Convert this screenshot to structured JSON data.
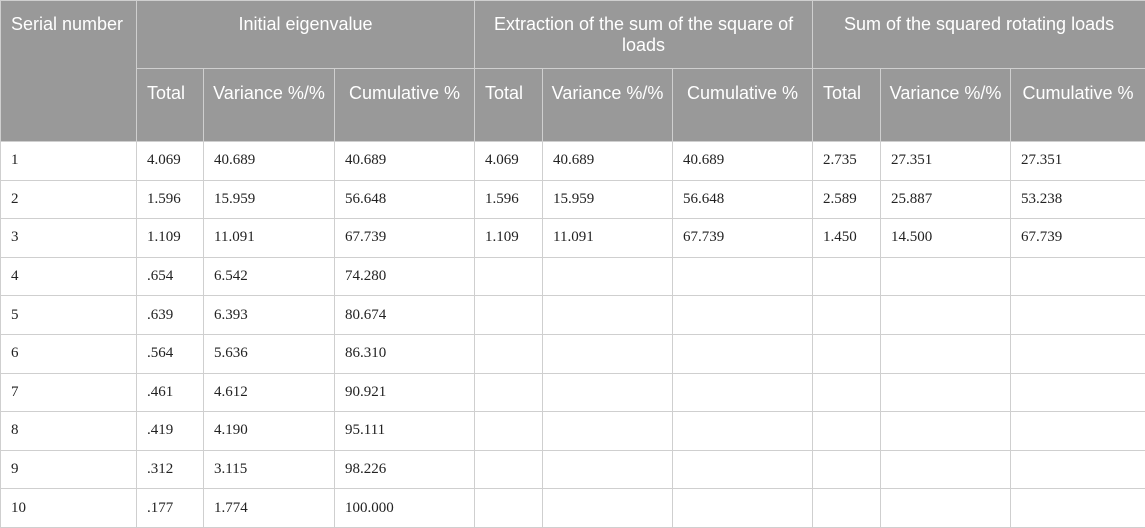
{
  "header": {
    "serial_number": "Serial number",
    "groups": [
      "Initial eigenvalue",
      "Extraction of the sum of the square of loads",
      "Sum of the squared rotating loads"
    ],
    "sub_total": "Total",
    "sub_variance": "Variance %/%",
    "sub_cumulative": "Cumulative %"
  },
  "rows": [
    [
      "1",
      "4.069",
      "40.689",
      "40.689",
      "4.069",
      "40.689",
      "40.689",
      "2.735",
      "27.351",
      "27.351"
    ],
    [
      "2",
      "1.596",
      "15.959",
      "56.648",
      "1.596",
      "15.959",
      "56.648",
      "2.589",
      "25.887",
      "53.238"
    ],
    [
      "3",
      "1.109",
      "11.091",
      "67.739",
      "1.109",
      "11.091",
      "67.739",
      "1.450",
      "14.500",
      "67.739"
    ],
    [
      "4",
      ".654",
      "6.542",
      "74.280",
      "",
      "",
      "",
      "",
      "",
      ""
    ],
    [
      "5",
      ".639",
      "6.393",
      "80.674",
      "",
      "",
      "",
      "",
      "",
      ""
    ],
    [
      "6",
      ".564",
      "5.636",
      "86.310",
      "",
      "",
      "",
      "",
      "",
      ""
    ],
    [
      "7",
      ".461",
      "4.612",
      "90.921",
      "",
      "",
      "",
      "",
      "",
      ""
    ],
    [
      "8",
      ".419",
      "4.190",
      "95.111",
      "",
      "",
      "",
      "",
      "",
      ""
    ],
    [
      "9",
      ".312",
      "3.115",
      "98.226",
      "",
      "",
      "",
      "",
      "",
      ""
    ],
    [
      "10",
      ".177",
      "1.774",
      "100.000",
      "",
      "",
      "",
      "",
      "",
      ""
    ]
  ]
}
